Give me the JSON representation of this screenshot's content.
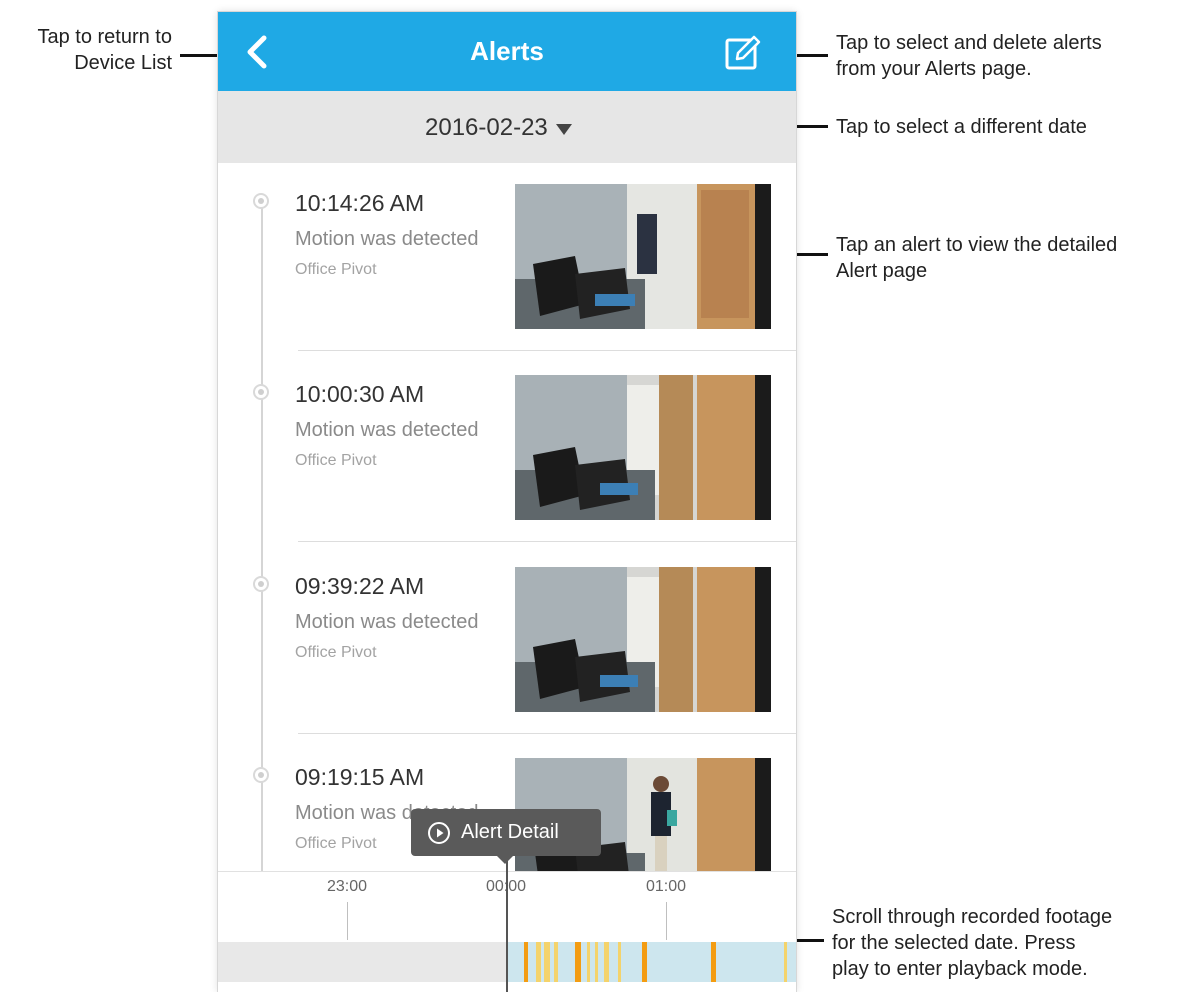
{
  "header": {
    "title": "Alerts",
    "back_icon": "chevron-left-icon",
    "edit_icon": "edit-icon"
  },
  "date_selector": {
    "value": "2016-02-23",
    "icon": "caret-down-icon"
  },
  "alerts": [
    {
      "time": "10:14:26 AM",
      "description": "Motion was detected",
      "device": "Office Pivot"
    },
    {
      "time": "10:00:30 AM",
      "description": "Motion was detected",
      "device": "Office Pivot"
    },
    {
      "time": "09:39:22 AM",
      "description": "Motion was detected",
      "device": "Office Pivot"
    },
    {
      "time": "09:19:15 AM",
      "description": "Motion was detected",
      "device": "Office Pivot"
    }
  ],
  "timeline": {
    "ticks": [
      "23:00",
      "00:00",
      "01:00"
    ]
  },
  "tooltip": {
    "label": "Alert Detail",
    "icon": "play-circle-icon"
  },
  "annotations": {
    "back": "Tap to return to\nDevice List",
    "edit": "Tap to select and delete alerts\nfrom your Alerts page.",
    "date": "Tap to select a different date",
    "alert": "Tap an alert to view the detailed\nAlert page",
    "timeline": "Scroll through recorded footage\nfor the selected date. Press\nplay to enter playback mode."
  },
  "colors": {
    "header": "#1fa9e5",
    "recorded": "#cde6ee",
    "event_orange": "#f39c12",
    "event_yellow": "#f4d36b"
  }
}
